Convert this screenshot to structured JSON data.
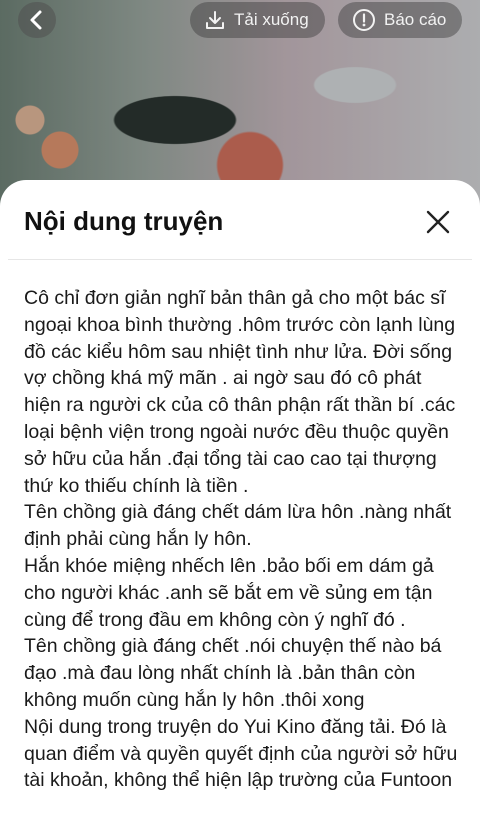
{
  "header": {
    "download_label": "Tải xuống",
    "report_label": "Báo cáo"
  },
  "sheet": {
    "title": "Nội dung truyện",
    "body": "Cô chỉ đơn giản nghĩ bản thân gả cho một bác sĩ ngoại khoa bình thường .hôm trước còn lạnh lùng đồ các kiểu hôm sau nhiệt tình như lửa. Đời sống vợ chồng khá mỹ mãn . ai ngờ sau đó cô phát hiện ra người ck của cô thân phận rất thần bí .các loại bệnh viện trong ngoài nước đều thuộc quyền sở hữu của hắn .đại tổng tài cao cao tại thượng thứ ko thiếu chính là tiền .\nTên chồng già đáng chết dám lừa hôn .nàng nhất định phải cùng hắn ly hôn.\nHắn khóe miệng nhếch lên .bảo bối em dám gả cho người khác .anh sẽ bắt em về sủng em tận cùng để trong đầu em không còn ý nghĩ đó .\nTên chồng già đáng chết .nói chuyện thế nào bá đạo .mà đau lòng nhất chính là .bản thân còn không muốn cùng hắn ly hôn .thôi xong\nNội dung trong truyện do Yui Kino đăng tải. Đó là quan điểm và quyền quyết định của người sở hữu tài khoản, không thể hiện lập trường của Funtoon"
  }
}
